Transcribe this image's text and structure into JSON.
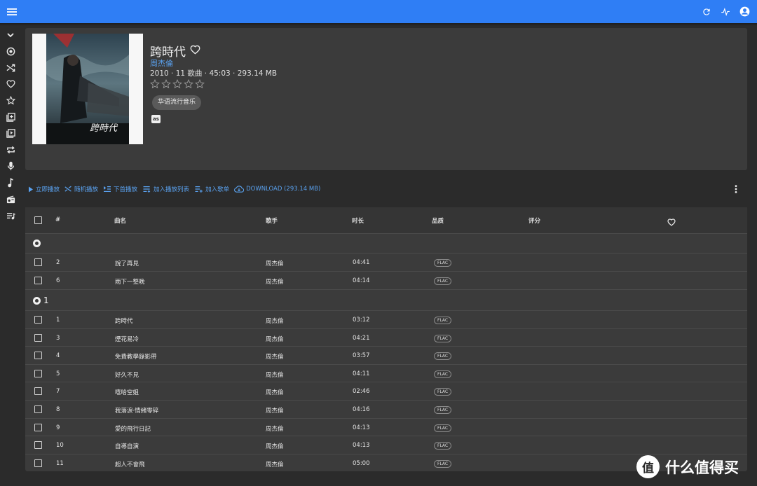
{
  "colors": {
    "appbar": "#2f7ef5",
    "accent": "#5aa2f0",
    "background": "#2b2b2b",
    "card": "#3b3b3b"
  },
  "appbar": {
    "menu_icon": "hamburger-menu-icon",
    "right_icons": [
      "refresh-icon",
      "activity-icon",
      "account-icon"
    ]
  },
  "sidebar": {
    "items": [
      "chevron-down-icon",
      "album-icon",
      "shuffle-icon",
      "heart-icon",
      "star-icon",
      "library-add-icon",
      "video-library-icon",
      "repeat-icon",
      "microphone-icon",
      "music-note-icon",
      "radio-icon",
      "playlist-icon"
    ]
  },
  "album": {
    "title": "跨時代",
    "artist": "周杰倫",
    "meta": "2010 · 11 歌曲 · 45:03 · 293.14 MB",
    "rating": 0,
    "rating_max": 5,
    "genre": "华语流行音乐",
    "lastfm_label": "as",
    "cover_text": "跨時代"
  },
  "actions": {
    "play_now": "立即播放",
    "shuffle": "随机播放",
    "play_next": "下首播放",
    "add_to_queue": "加入播放列表",
    "add_to_playlist": "加入歌单",
    "download": "DOWNLOAD (293.14 MB)"
  },
  "table": {
    "headers": {
      "num": "#",
      "title": "曲名",
      "artist": "歌手",
      "duration": "时长",
      "quality": "品质",
      "rating": "评分"
    },
    "disc_1_label": "",
    "disc_2_label": "1",
    "disc1_tracks": [
      {
        "num": "2",
        "title": "說了再見",
        "artist": "周杰倫",
        "duration": "04:41",
        "quality": "FLAC"
      },
      {
        "num": "6",
        "title": "雨下一整晚",
        "artist": "周杰倫",
        "duration": "04:14",
        "quality": "FLAC"
      }
    ],
    "disc2_tracks": [
      {
        "num": "1",
        "title": "跨時代",
        "artist": "周杰倫",
        "duration": "03:12",
        "quality": "FLAC"
      },
      {
        "num": "3",
        "title": "煙花易冷",
        "artist": "周杰倫",
        "duration": "04:21",
        "quality": "FLAC"
      },
      {
        "num": "4",
        "title": "免費教學錄影帶",
        "artist": "周杰倫",
        "duration": "03:57",
        "quality": "FLAC"
      },
      {
        "num": "5",
        "title": "好久不見",
        "artist": "周杰倫",
        "duration": "04:11",
        "quality": "FLAC"
      },
      {
        "num": "7",
        "title": "嘻哈空姐",
        "artist": "周杰倫",
        "duration": "02:46",
        "quality": "FLAC"
      },
      {
        "num": "8",
        "title": "我落淚·情緒零碎",
        "artist": "周杰倫",
        "duration": "04:16",
        "quality": "FLAC"
      },
      {
        "num": "9",
        "title": "愛的飛行日記",
        "artist": "周杰倫",
        "duration": "04:13",
        "quality": "FLAC"
      },
      {
        "num": "10",
        "title": "自導自演",
        "artist": "周杰倫",
        "duration": "04:13",
        "quality": "FLAC"
      },
      {
        "num": "11",
        "title": "超人不會飛",
        "artist": "周杰倫",
        "duration": "05:00",
        "quality": "FLAC"
      }
    ]
  },
  "watermark": {
    "text": "什么值得买",
    "logo_text": "值"
  }
}
